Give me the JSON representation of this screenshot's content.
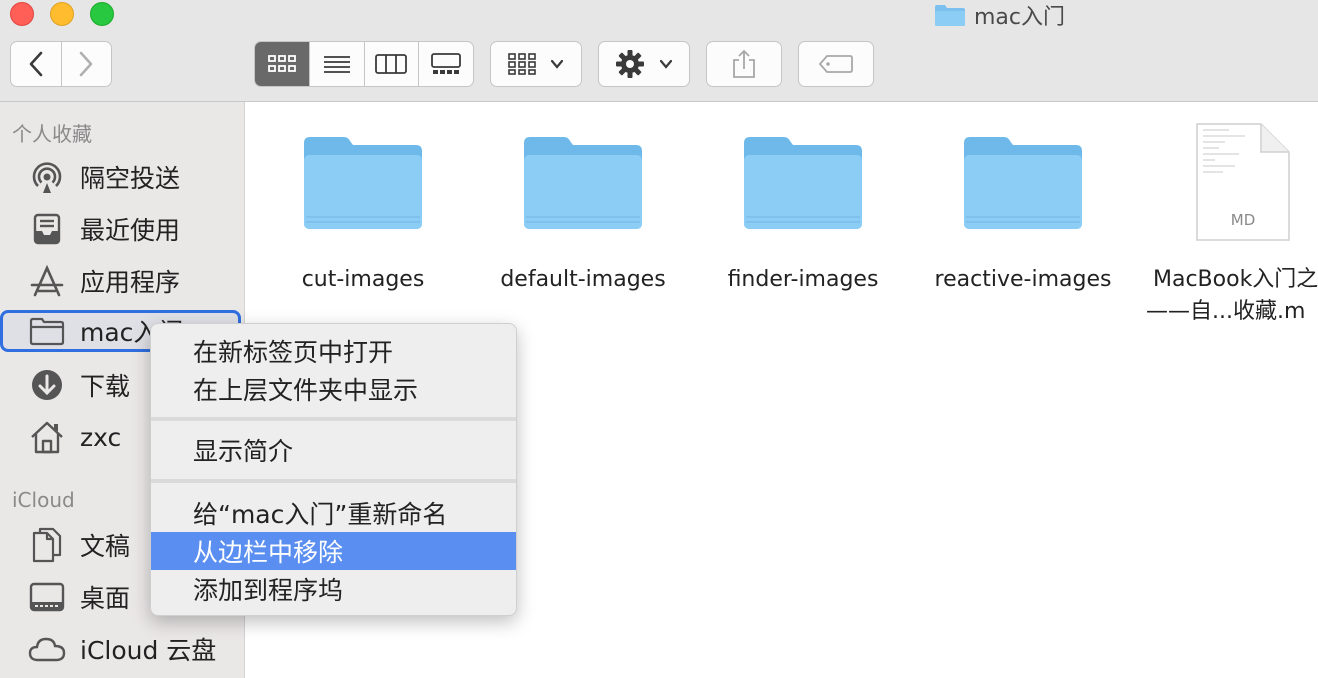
{
  "window": {
    "title": "mac入门"
  },
  "sidebar": {
    "favorites_header": "个人收藏",
    "icloud_header": "iCloud",
    "favorites": [
      {
        "label": "隔空投送",
        "icon": "airdrop-icon"
      },
      {
        "label": "最近使用",
        "icon": "recents-icon"
      },
      {
        "label": "应用程序",
        "icon": "applications-icon"
      },
      {
        "label": "mac入门",
        "icon": "folder-icon",
        "selected": true
      },
      {
        "label": "下载",
        "icon": "download-icon"
      },
      {
        "label": "zxc",
        "icon": "home-icon"
      }
    ],
    "icloud": [
      {
        "label": "文稿",
        "icon": "documents-icon"
      },
      {
        "label": "桌面",
        "icon": "desktop-icon"
      },
      {
        "label": "iCloud 云盘",
        "icon": "cloud-icon"
      }
    ]
  },
  "files": [
    {
      "name": "cut-images",
      "type": "folder"
    },
    {
      "name": "default-images",
      "type": "folder"
    },
    {
      "name": "finder-images",
      "type": "folder"
    },
    {
      "name": "reactive-images",
      "type": "folder"
    },
    {
      "name": "MacBook入门之",
      "name_line2": "——自...收藏.m",
      "type": "md",
      "badge": "MD"
    }
  ],
  "context_menu": {
    "items": [
      {
        "label": "在新标签页中打开"
      },
      {
        "label": "在上层文件夹中显示"
      },
      {
        "label": "显示简介"
      },
      {
        "label": "给“mac入门”重新命名"
      },
      {
        "label": "从边栏中移除",
        "highlighted": true
      },
      {
        "label": "添加到程序坞"
      }
    ]
  },
  "colors": {
    "accent": "#2f6fdf",
    "highlight": "#5a8ef0",
    "folder": "#8ccdf6"
  }
}
